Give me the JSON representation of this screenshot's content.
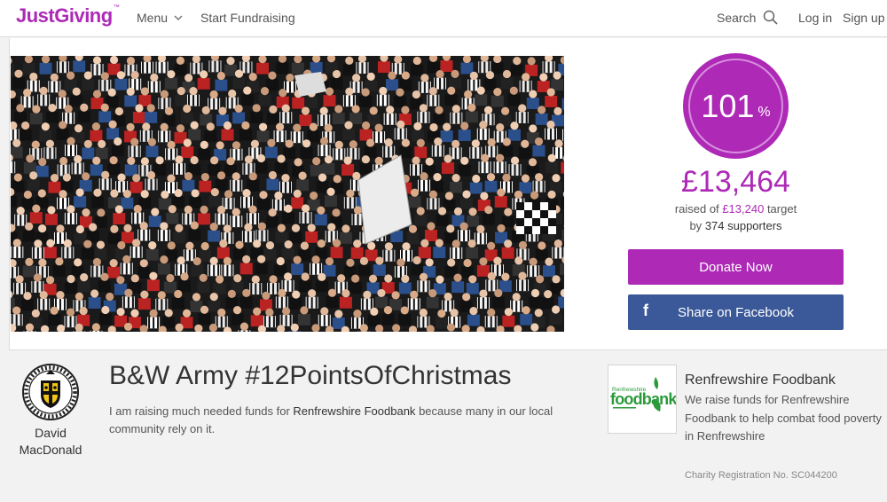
{
  "header": {
    "logo_text": "JustGiving",
    "logo_tm": "™",
    "menu_label": "Menu",
    "start_fundraising_label": "Start Fundraising",
    "search_label": "Search",
    "login_label": "Log in",
    "signup_label": "Sign up"
  },
  "campaign": {
    "progress_percent": "101",
    "progress_sign": "%",
    "raised_amount": "£13,464",
    "target_prefix": "raised of",
    "target_amount": "£13,240",
    "target_suffix": "target",
    "supporters_prefix": "by",
    "supporters_count": "374 supporters",
    "donate_label": "Donate Now",
    "facebook_icon_glyph": "f",
    "facebook_label": "Share on Facebook",
    "accent_color": "#ad29b6",
    "facebook_color": "#3b5998"
  },
  "fundraiser": {
    "name": "David MacDonald",
    "page_title": "B&W Army #12PointsOfChristmas",
    "story_prefix": "I am raising much needed funds for",
    "story_charity": "Renfrewshire Foodbank",
    "story_suffix": "because many in our local community rely on it.",
    "crest_icon": "st-mirren-crest-icon"
  },
  "charity": {
    "logo_small_text": "Renfrewshire",
    "logo_text": "foodbank",
    "name": "Renfrewshire Foodbank",
    "description": "We raise funds for Renfrewshire Foodbank to help combat food poverty in Renfrewshire",
    "registration": "Charity Registration No. SC044200"
  }
}
